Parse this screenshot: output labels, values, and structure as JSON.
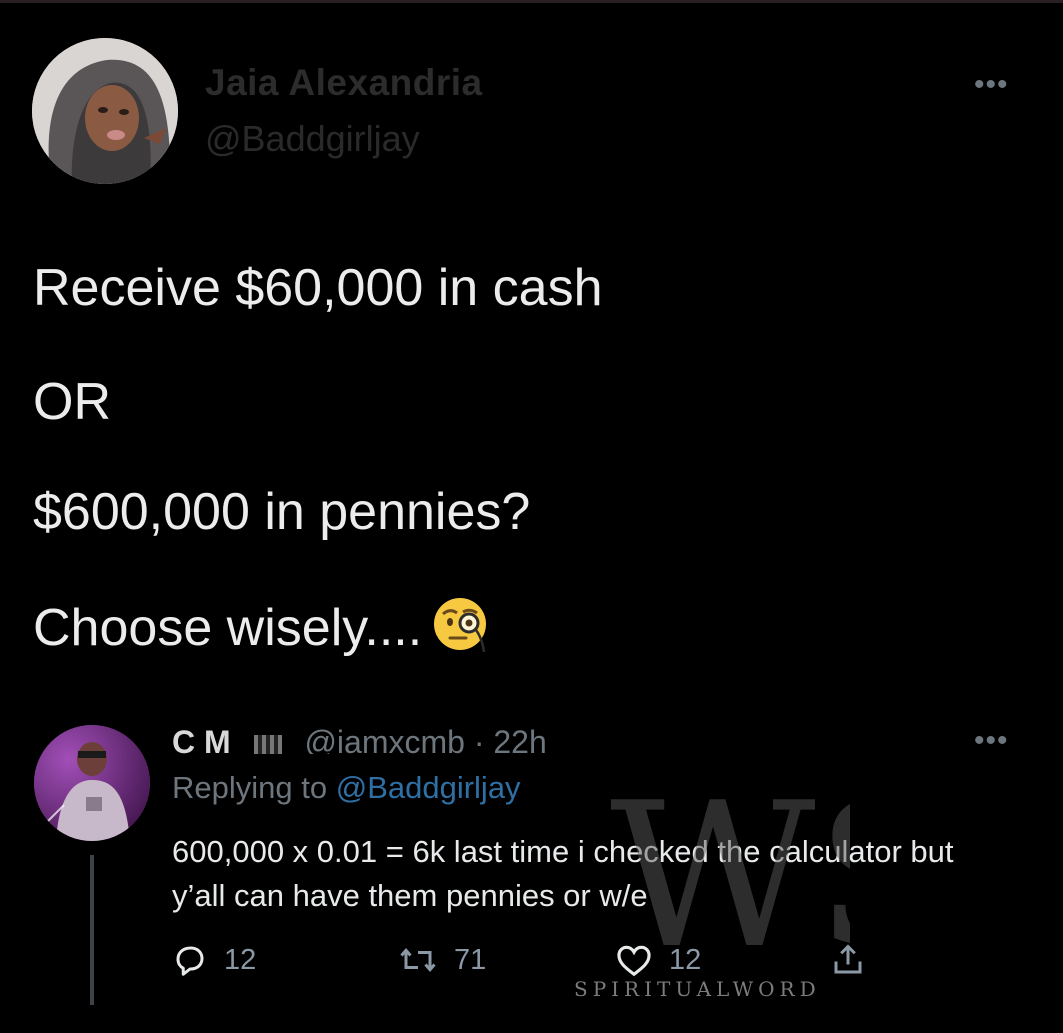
{
  "tweet": {
    "author_name": "Jaia Alexandria",
    "author_handle": "@Baddgirljay",
    "more_icon": "more-dots-icon",
    "lines": [
      "Receive $60,000 in cash",
      "OR",
      "$600,000 in pennies?",
      "Choose wisely...."
    ],
    "emoji": "face-with-monocle"
  },
  "reply": {
    "author_name": "C M",
    "author_handle": "@iamxcmb",
    "time": "· 22h",
    "replying_prefix": "Replying to",
    "replying_handle": "@Baddgirljay",
    "text": "600,000 x 0.01 = 6k  last time i checked the calculator but y’all can have them pennies or w/e",
    "counts": {
      "replies": "12",
      "retweets": "71",
      "likes": "12"
    },
    "icons": [
      "reply-icon",
      "retweet-icon",
      "like-icon",
      "share-icon"
    ]
  },
  "watermark": {
    "monogram": "WS",
    "text": "SPIRITUALWORD"
  },
  "colors": {
    "background": "#000000",
    "text": "#e7e9ea",
    "muted": "#6e767d",
    "link": "#2f6fa3"
  }
}
